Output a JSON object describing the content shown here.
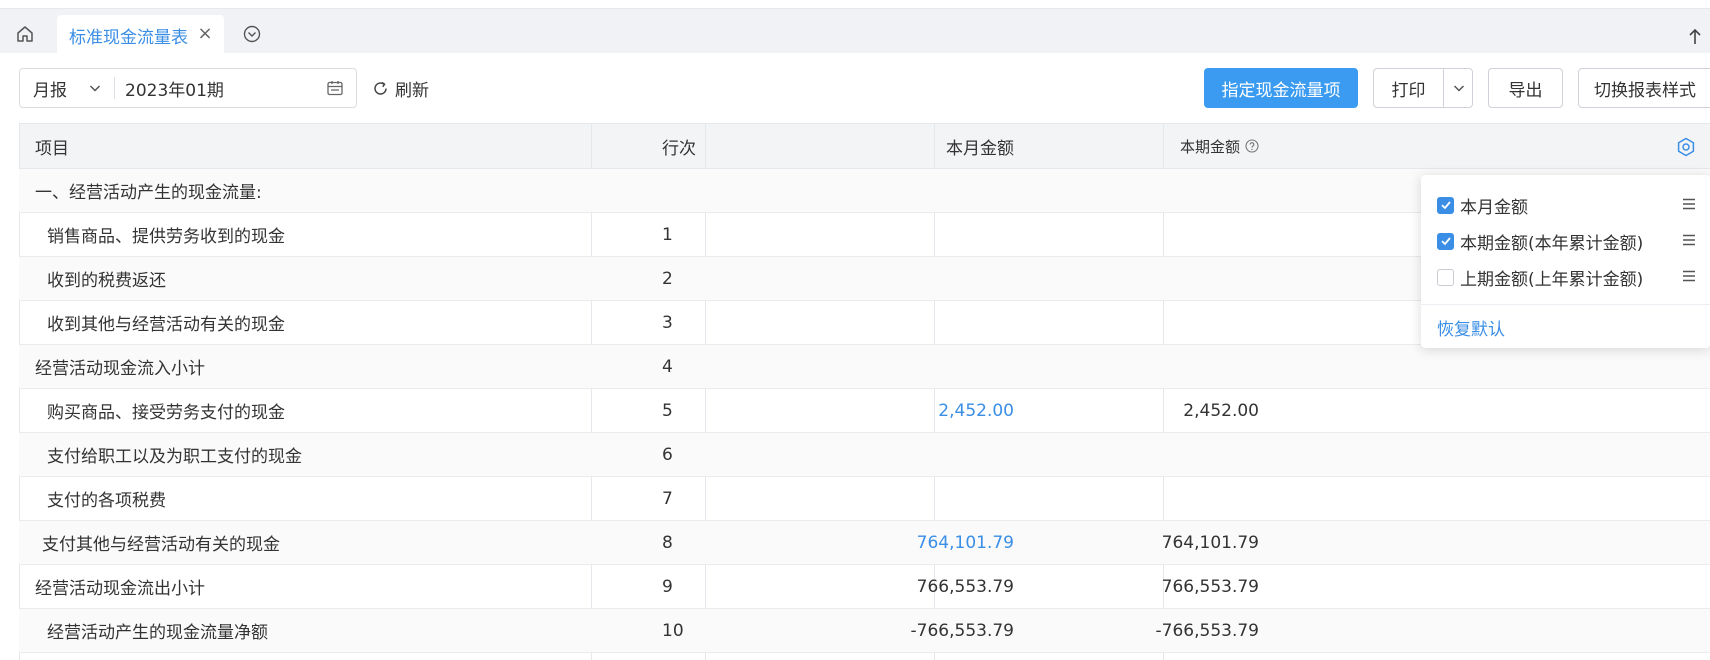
{
  "tabs": {
    "active_label": "标准现金流量表"
  },
  "toolbar": {
    "period_type": "月报",
    "period_value": "2023年01期",
    "refresh_label": "刷新",
    "assign_label": "指定现金流量项",
    "print_label": "打印",
    "export_label": "导出",
    "switch_label": "切换报表样式"
  },
  "table": {
    "headers": {
      "item": "项目",
      "line": "行次",
      "month_amount": "本月金额",
      "period_amount": "本期金额"
    },
    "rows": [
      {
        "item": "一、经营活动产生的现金流量:",
        "line": "",
        "month": "",
        "period": ""
      },
      {
        "item": "销售商品、提供劳务收到的现金",
        "line": "1",
        "month": "",
        "period": ""
      },
      {
        "item": "收到的税费返还",
        "line": "2",
        "month": "",
        "period": ""
      },
      {
        "item": "收到其他与经营活动有关的现金",
        "line": "3",
        "month": "",
        "period": ""
      },
      {
        "item": "经营活动现金流入小计",
        "line": "4",
        "month": "",
        "period": ""
      },
      {
        "item": "购买商品、接受劳务支付的现金",
        "line": "5",
        "month": "2,452.00",
        "period": "2,452.00"
      },
      {
        "item": "支付给职工以及为职工支付的现金",
        "line": "6",
        "month": "",
        "period": ""
      },
      {
        "item": "支付的各项税费",
        "line": "7",
        "month": "",
        "period": ""
      },
      {
        "item": "支付其他与经营活动有关的现金",
        "line": "8",
        "month": "764,101.79",
        "period": "764,101.79"
      },
      {
        "item": "经营活动现金流出小计",
        "line": "9",
        "month": "766,553.79",
        "period": "766,553.79"
      },
      {
        "item": "经营活动产生的现金流量净额",
        "line": "10",
        "month": "-766,553.79",
        "period": "-766,553.79"
      }
    ]
  },
  "column_settings": {
    "items": [
      {
        "label": "本月金额",
        "checked": true
      },
      {
        "label": "本期金额(本年累计金额)",
        "checked": true
      },
      {
        "label": "上期金额(上年累计金额)",
        "checked": false
      }
    ],
    "reset_label": "恢复默认"
  },
  "colors": {
    "primary": "#3a9bf0",
    "link": "#3a8ee6"
  }
}
